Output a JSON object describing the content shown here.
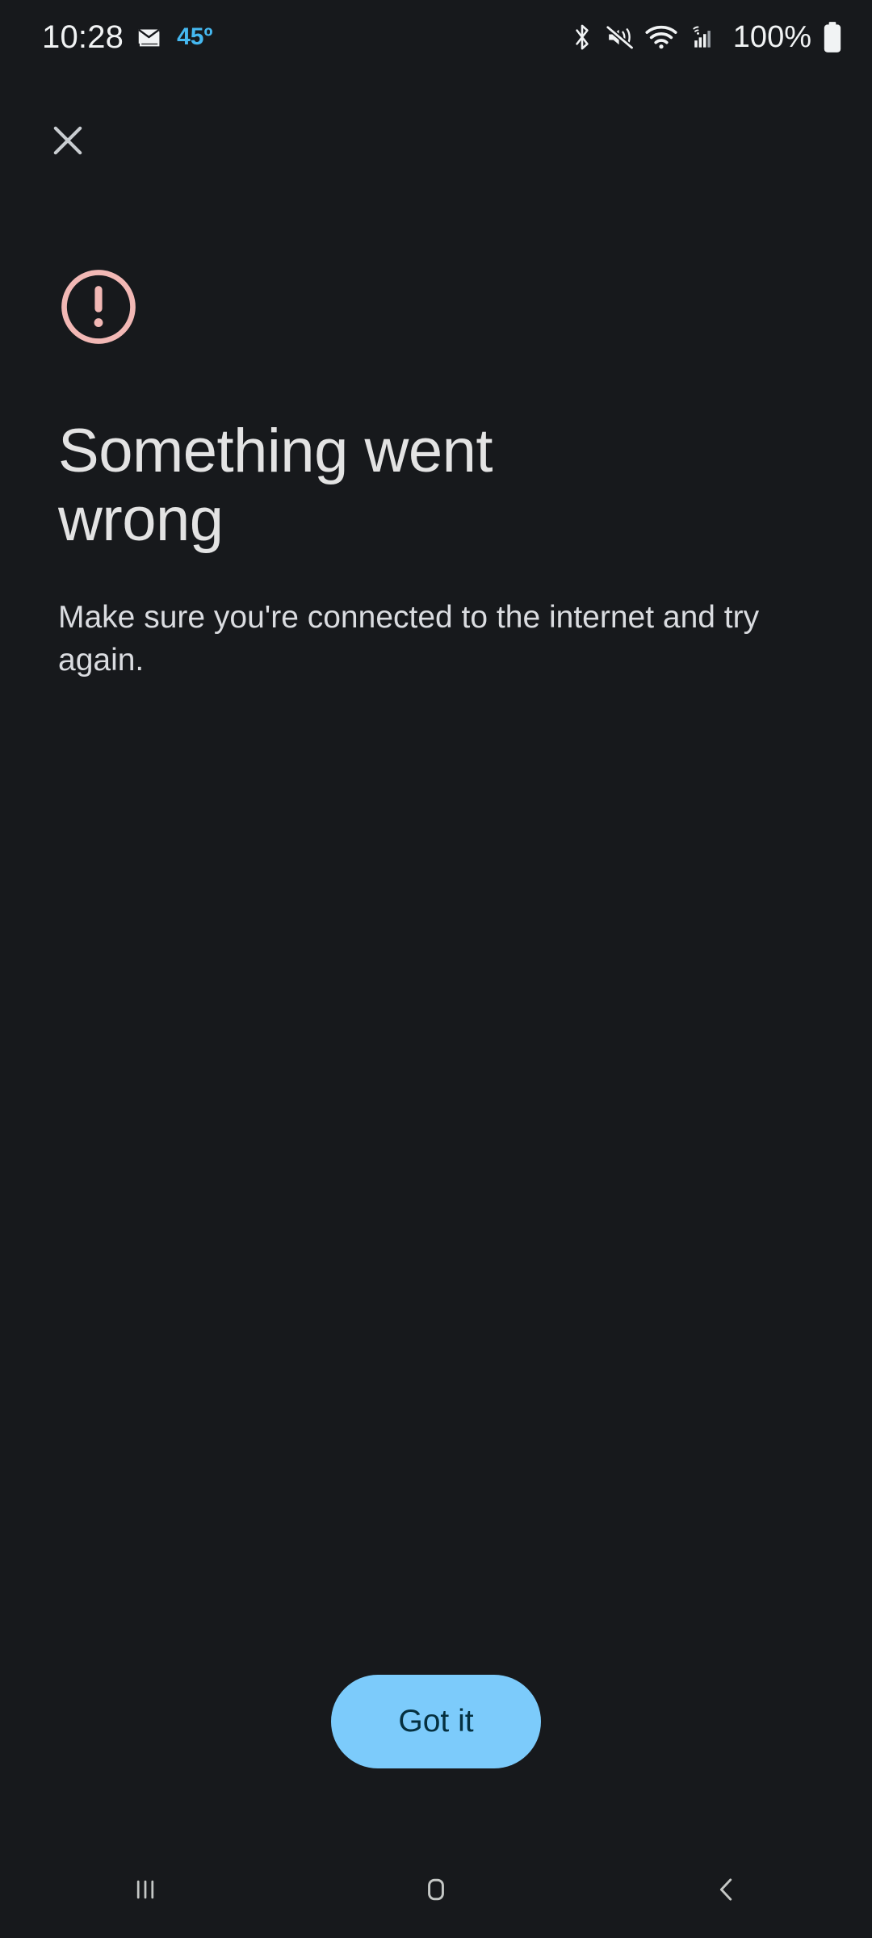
{
  "status_bar": {
    "time": "10:28",
    "temperature": "45º",
    "battery_percent": "100%",
    "icons": {
      "mail": "mail-stack-icon",
      "bluetooth": "bluetooth-icon",
      "sound_off": "mute-vibrate-icon",
      "wifi": "wifi-icon",
      "cellular": "cellular-signal-icon",
      "battery": "battery-full-icon"
    }
  },
  "top_bar": {
    "close_icon": "close-icon"
  },
  "dialog": {
    "status_icon": "error-circle-exclamation-icon",
    "title": "Something went wrong",
    "message": "Make sure you're connected to the internet and try again.",
    "primary_button_label": "Got it"
  },
  "nav_bar": {
    "recents_icon": "recents-icon",
    "home_icon": "home-icon",
    "back_icon": "back-icon"
  },
  "colors": {
    "background": "#17191c",
    "error_accent": "#f2b8b5",
    "title_text": "#e3e3e3",
    "body_text": "#dadce0",
    "button_fill": "#7ccbfb",
    "button_text": "#05303f",
    "temperature_text": "#45b8f0",
    "status_icon": "#f1f3f4",
    "nav_icon": "#c4c7c5"
  }
}
